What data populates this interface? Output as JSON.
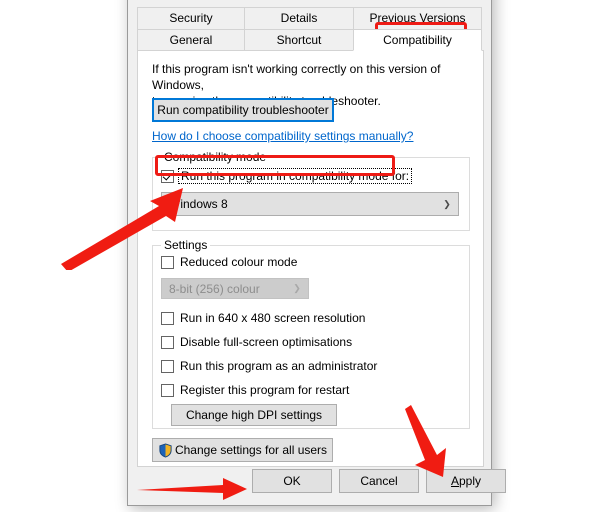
{
  "dialog": {
    "tabs_row1": [
      {
        "label": "Security",
        "active": false
      },
      {
        "label": "Details",
        "active": false
      },
      {
        "label": "Previous Versions",
        "active": false
      }
    ],
    "tabs_row2": [
      {
        "label": "General",
        "active": false
      },
      {
        "label": "Shortcut",
        "active": false
      },
      {
        "label": "Compatibility",
        "active": true
      }
    ],
    "intro_line1": "If this program isn't working correctly on this version of Windows,",
    "intro_line2": "try running the compatibility troubleshooter.",
    "run_troubleshooter_label": "Run compatibility troubleshooter",
    "help_link_label": "How do I choose compatibility settings manually?",
    "compatibility_mode": {
      "group_title": "Compatibility mode",
      "checkbox_label": "Run this program in compatibility mode for:",
      "checkbox_checked": true,
      "os_select_value": "Windows 8",
      "os_select_enabled": true
    },
    "settings": {
      "group_title": "Settings",
      "reduced_colour_label": "Reduced colour mode",
      "reduced_colour_checked": false,
      "colour_depth_value": "8-bit (256) colour",
      "colour_depth_enabled": false,
      "checkboxes": [
        {
          "label": "Run in 640 x 480 screen resolution",
          "checked": false
        },
        {
          "label": "Disable full-screen optimisations",
          "checked": false
        },
        {
          "label": "Run this program as an administrator",
          "checked": false
        },
        {
          "label": "Register this program for restart",
          "checked": false
        }
      ],
      "high_dpi_label": "Change high DPI settings"
    },
    "change_all_users_label": "Change settings for all users",
    "change_all_users_icon": "uac-shield-icon",
    "footer": {
      "ok_label": "OK",
      "cancel_label": "Cancel",
      "apply_label_prefix": "A",
      "apply_label_rest": "pply"
    }
  },
  "annotations": {
    "highlight_color": "#ee1b15",
    "boxes": [
      {
        "name": "compatibility-tab-highlight"
      },
      {
        "name": "compatibility-mode-checkbox-highlight"
      }
    ],
    "arrows": [
      {
        "name": "arrow-to-compatibility-mode",
        "direction": "up-right"
      },
      {
        "name": "arrow-to-ok-button",
        "direction": "right"
      },
      {
        "name": "arrow-to-apply-button",
        "direction": "down"
      }
    ]
  },
  "theme": {
    "focus_border": "#0078d7",
    "link_color": "#0066cc",
    "dialog_bg": "#f0f0f0",
    "page_bg": "#ffffff",
    "button_bg": "#e1e1e1"
  }
}
